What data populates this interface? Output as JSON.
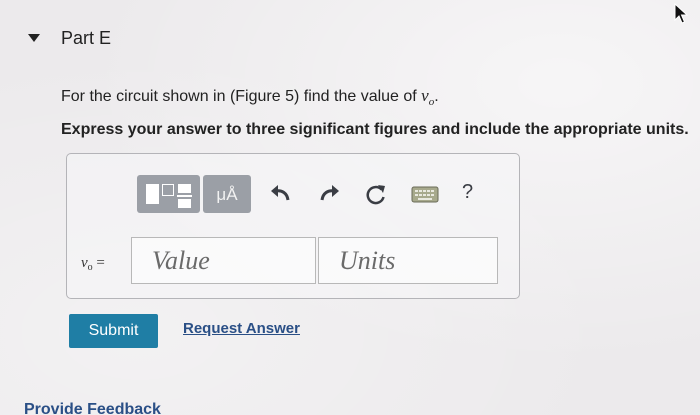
{
  "part": {
    "title": "Part E"
  },
  "question": {
    "text_before": "For the circuit shown in (",
    "figure_link": "Figure 5",
    "text_after": ") find the value of ",
    "variable": "v",
    "variable_sub": "o",
    "end": "."
  },
  "instruction": "Express your answer to three significant figures and include the appropriate units.",
  "toolbar": {
    "units_label": "μÅ",
    "icons": [
      "templates-icon",
      "units-icon",
      "undo-icon",
      "redo-icon",
      "reset-icon",
      "keyboard-icon",
      "help-icon"
    ],
    "help_label": "?"
  },
  "answer": {
    "variable": "v",
    "variable_sub": "o",
    "equals": " =",
    "value_placeholder": "Value",
    "units_placeholder": "Units"
  },
  "actions": {
    "submit_label": "Submit",
    "request_answer_label": "Request Answer"
  },
  "footer": {
    "feedback_label": "Provide Feedback"
  }
}
